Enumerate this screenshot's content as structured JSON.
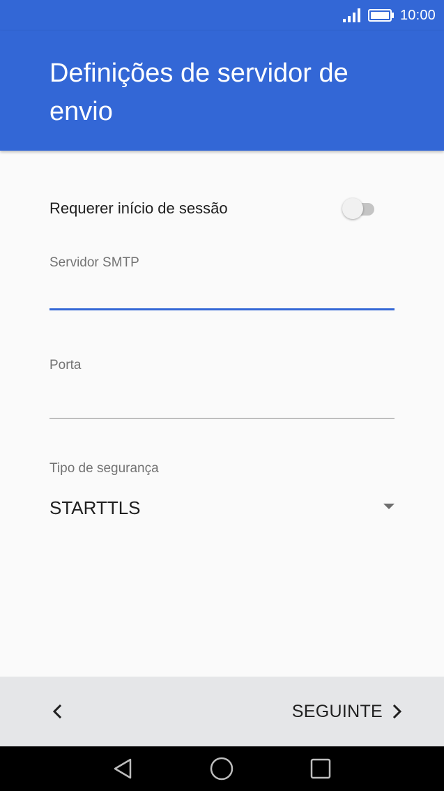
{
  "status_bar": {
    "time": "10:00",
    "icons": [
      "signal-icon",
      "battery-icon"
    ]
  },
  "header": {
    "title": "Definições de servidor de envio",
    "background_color": "#3367d6"
  },
  "form": {
    "require_login": {
      "label": "Requerer início de sessão",
      "enabled": false
    },
    "smtp_server": {
      "label": "Servidor SMTP",
      "value": ""
    },
    "port": {
      "label": "Porta",
      "value": ""
    },
    "security_type": {
      "label": "Tipo de segurança",
      "selected": "STARTTLS"
    }
  },
  "bottom_bar": {
    "next_label": "SEGUINTE",
    "icons": [
      "chevron-left-icon",
      "chevron-right-icon"
    ]
  },
  "nav_bar": {
    "icons": [
      "back-triangle-icon",
      "home-circle-icon",
      "recents-square-icon"
    ]
  },
  "colors": {
    "accent": "#3367d6",
    "text": "#202020",
    "label": "#737373",
    "toolbar_bg": "#e5e6e8"
  }
}
